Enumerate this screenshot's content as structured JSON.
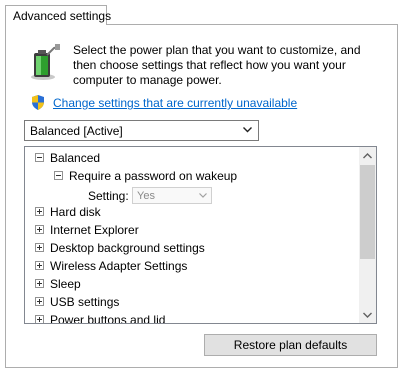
{
  "tab": {
    "label": "Advanced settings"
  },
  "description": "Select the power plan that you want to customize, and then choose settings that reflect how you want your computer to manage power.",
  "change_link": "Change settings that are currently unavailable",
  "plan_select": {
    "value": "Balanced [Active]"
  },
  "tree": {
    "root": "Balanced",
    "child": "Require a password on wakeup",
    "setting_label": "Setting:",
    "setting_value": "Yes",
    "items": [
      "Hard disk",
      "Internet Explorer",
      "Desktop background settings",
      "Wireless Adapter Settings",
      "Sleep",
      "USB settings",
      "Power buttons and lid"
    ]
  },
  "restore_button": "Restore plan defaults",
  "icons": {
    "battery": "battery-plug-icon",
    "shield": "uac-shield-icon",
    "chevron": "chevron-down-icon"
  }
}
